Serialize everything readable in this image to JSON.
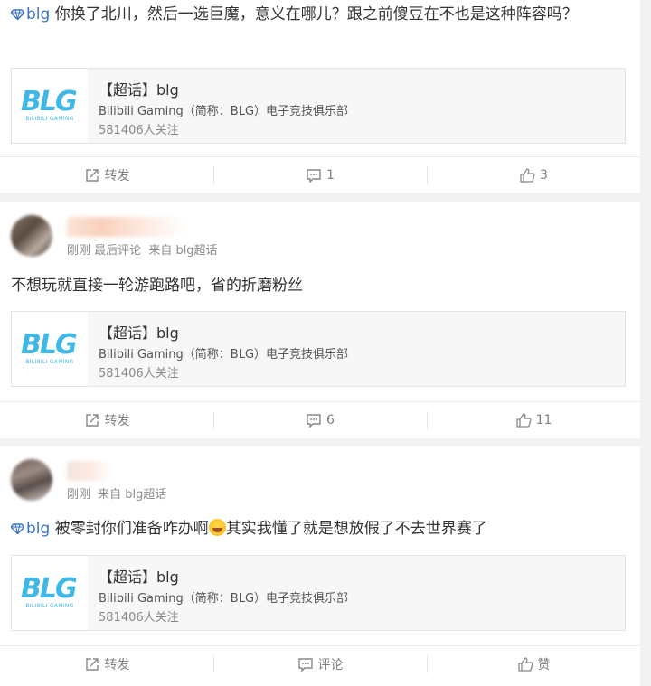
{
  "posts": [
    {
      "tag": "blg",
      "text": "你换了北川，然后一选巨魔，意义在哪儿？跟之前傻豆在不也是这种阵容吗？",
      "embed": {
        "title": "【超话】blg",
        "desc": "Bilibili Gaming（简称：BLG）电子竞技俱乐部",
        "follow": "581406人关注"
      },
      "actions": {
        "repost": "转发",
        "comment": "1",
        "like": "3"
      }
    },
    {
      "meta_time": "刚刚",
      "meta_extra": "最后评论",
      "meta_source": "来自 blg超话",
      "text": "不想玩就直接一轮游跑路吧，省的折磨粉丝",
      "embed": {
        "title": "【超话】blg",
        "desc": "Bilibili Gaming（简称：BLG）电子竞技俱乐部",
        "follow": "581406人关注"
      },
      "actions": {
        "repost": "转发",
        "comment": "6",
        "like": "11"
      }
    },
    {
      "meta_time": "刚刚",
      "meta_source": "来自 blg超话",
      "tag": "blg",
      "text_before": "被零封你们准备咋办啊",
      "text_after": "其实我懂了就是想放假了不去世界赛了",
      "embed": {
        "title": "【超话】blg",
        "desc": "Bilibili Gaming（简称：BLG）电子竞技俱乐部",
        "follow": "581406人关注"
      },
      "actions": {
        "repost": "转发",
        "comment": "评论",
        "like": "赞"
      }
    }
  ],
  "logo": {
    "main": "BLG",
    "sub": "BILIBILI GAMING"
  },
  "colors": {
    "accent": "#3b73c4",
    "logo": "#3fb8e6",
    "background": "#f2f2f2"
  },
  "icons": [
    "diamond-icon",
    "repost-icon",
    "comment-icon",
    "like-icon",
    "laugh-emoji-icon"
  ]
}
